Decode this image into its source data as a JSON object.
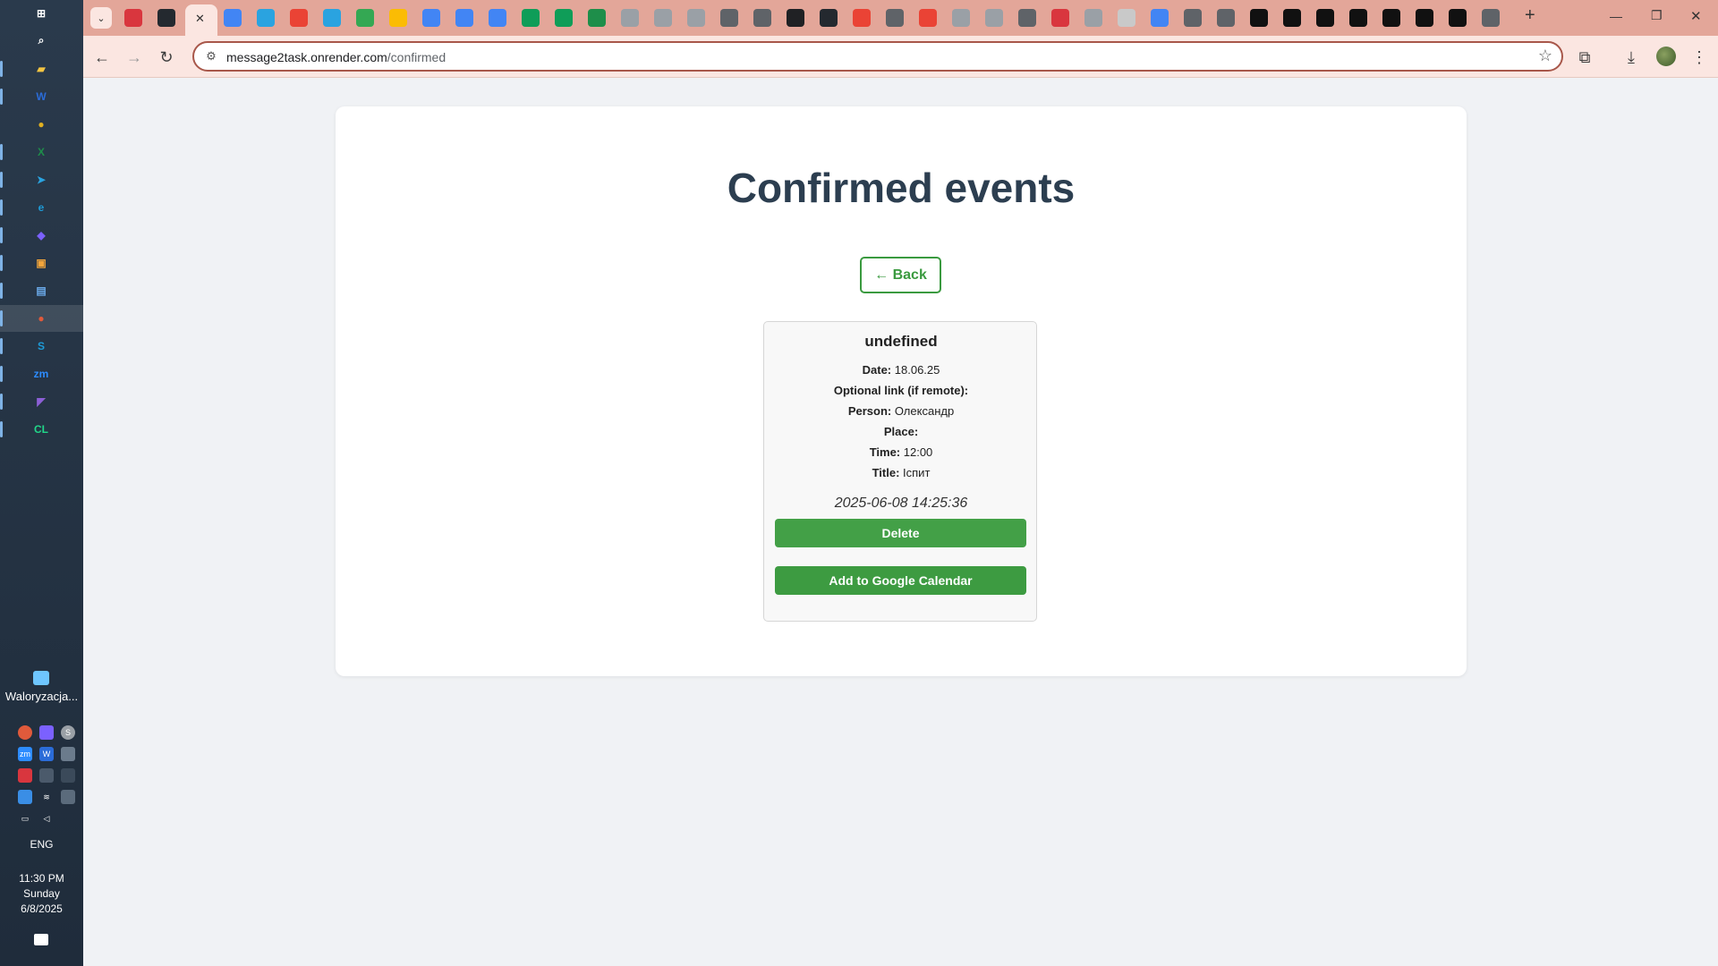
{
  "taskbar": {
    "pinned": [
      {
        "name": "start",
        "glyph": "⊞",
        "color": "#ffffff"
      },
      {
        "name": "search",
        "glyph": "⌕",
        "color": "#ffffff"
      },
      {
        "name": "file-explorer",
        "glyph": "▰",
        "color": "#f4c542"
      },
      {
        "name": "word",
        "glyph": "W",
        "color": "#2b6cd8"
      },
      {
        "name": "chrome",
        "glyph": "●",
        "color": "#e0b020"
      },
      {
        "name": "excel",
        "glyph": "X",
        "color": "#1e8e4a"
      },
      {
        "name": "telegram",
        "glyph": "➤",
        "color": "#2aa3e0"
      },
      {
        "name": "edge",
        "glyph": "e",
        "color": "#1e9ad6"
      },
      {
        "name": "copilot",
        "glyph": "◆",
        "color": "#7b61ff"
      },
      {
        "name": "photos",
        "glyph": "▣",
        "color": "#f2a53b"
      },
      {
        "name": "notepad",
        "glyph": "▤",
        "color": "#6aa9e8"
      },
      {
        "name": "chrome-active",
        "glyph": "●",
        "color": "#e05a3b"
      },
      {
        "name": "skype",
        "glyph": "S",
        "color": "#1d9bd8"
      },
      {
        "name": "zoom",
        "glyph": "zm",
        "color": "#2d8cff"
      },
      {
        "name": "visual-studio",
        "glyph": "◤",
        "color": "#8c5fd6"
      },
      {
        "name": "clion",
        "glyph": "CL",
        "color": "#21d789"
      }
    ],
    "widget_label": "Waloryzacja...",
    "language": "ENG",
    "clock_time": "11:30 PM",
    "clock_day": "Sunday",
    "clock_date": "6/8/2025"
  },
  "browser": {
    "url_host": "message2task.onrender.com",
    "url_path": "/confirmed",
    "tab_close_glyph": "✕",
    "new_tab_glyph": "+",
    "window_minimize": "—",
    "window_restore": "❐",
    "window_close": "✕"
  },
  "page": {
    "title": "Confirmed events",
    "back_label": "← Back",
    "event": {
      "title": "undefined",
      "fields": [
        {
          "label": "Date:",
          "value": "18.06.25"
        },
        {
          "label": "Optional link (if remote):",
          "value": ""
        },
        {
          "label": "Person:",
          "value": "Олександр"
        },
        {
          "label": "Place:",
          "value": ""
        },
        {
          "label": "Time:",
          "value": "12:00"
        },
        {
          "label": "Title:",
          "value": "Іспит"
        }
      ],
      "timestamp": "2025-06-08 14:25:36",
      "delete_label": "Delete",
      "gcal_label": "Add to Google Calendar"
    }
  }
}
